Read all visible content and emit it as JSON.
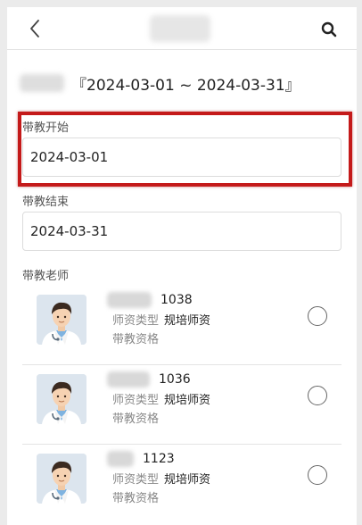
{
  "header": {
    "back_icon": "chevron-left-icon",
    "search_icon": "search-icon"
  },
  "summary": {
    "date_range": "『2024-03-01 ~ 2024-03-31』"
  },
  "form": {
    "start": {
      "label": "带教开始",
      "value": "2024-03-01"
    },
    "end": {
      "label": "带教结束",
      "value": "2024-03-31"
    },
    "teachers_label": "带教老师"
  },
  "teachers": [
    {
      "id": "1038",
      "type_key": "师资类型",
      "type_value": "规培师资",
      "qualification": "带教资格",
      "selected": false
    },
    {
      "id": "1036",
      "type_key": "师资类型",
      "type_value": "规培师资",
      "qualification": "带教资格",
      "selected": false
    },
    {
      "id": "1123",
      "type_key": "师资类型",
      "type_value": "规培师资",
      "qualification": "带教资格",
      "selected": false
    }
  ],
  "colors": {
    "highlight": "#c41a1a",
    "border": "#dcdcdc",
    "muted_text": "#888888"
  }
}
